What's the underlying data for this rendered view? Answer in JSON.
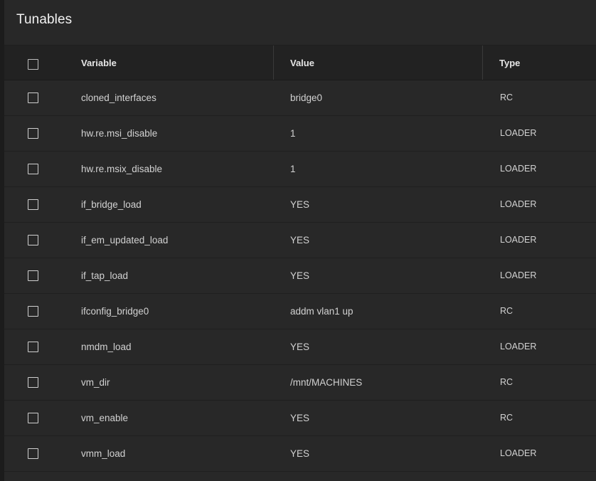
{
  "page": {
    "title": "Tunables"
  },
  "table": {
    "headers": {
      "variable": "Variable",
      "value": "Value",
      "type": "Type"
    },
    "rows": [
      {
        "variable": "cloned_interfaces",
        "value": "bridge0",
        "type": "RC"
      },
      {
        "variable": "hw.re.msi_disable",
        "value": "1",
        "type": "LOADER"
      },
      {
        "variable": "hw.re.msix_disable",
        "value": "1",
        "type": "LOADER"
      },
      {
        "variable": "if_bridge_load",
        "value": "YES",
        "type": "LOADER"
      },
      {
        "variable": "if_em_updated_load",
        "value": "YES",
        "type": "LOADER"
      },
      {
        "variable": "if_tap_load",
        "value": "YES",
        "type": "LOADER"
      },
      {
        "variable": "ifconfig_bridge0",
        "value": "addm vlan1 up",
        "type": "RC"
      },
      {
        "variable": "nmdm_load",
        "value": "YES",
        "type": "LOADER"
      },
      {
        "variable": "vm_dir",
        "value": "/mnt/MACHINES",
        "type": "RC"
      },
      {
        "variable": "vm_enable",
        "value": "YES",
        "type": "RC"
      },
      {
        "variable": "vmm_load",
        "value": "YES",
        "type": "LOADER"
      }
    ]
  }
}
